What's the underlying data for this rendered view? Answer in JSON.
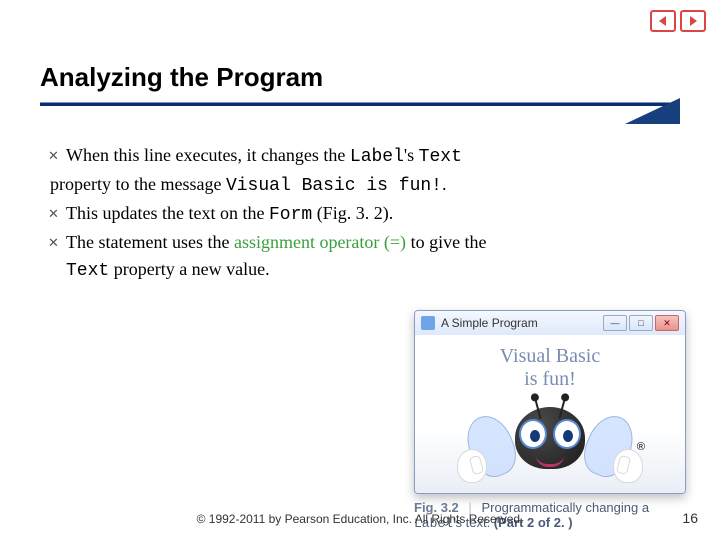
{
  "title": "Analyzing the Program",
  "bullets": {
    "b1_prefix": "When this line executes, it changes the ",
    "b1_label": "Label",
    "b1_poss": "'s ",
    "b1_text": "Text",
    "b1_line2a": "property to the message ",
    "b1_msg": "Visual Basic is fun!",
    "b1_line2b": ".",
    "b2_prefix": "This updates the text on the ",
    "b2_form": "Form",
    "b2_suffix": " (Fig. 3. 2).",
    "b3_prefix": "The statement uses the ",
    "b3_hl": "assignment operator (=) ",
    "b3_mid": "to give the ",
    "b3_text": "Text",
    "b3_suffix": " property a new value."
  },
  "window": {
    "title": "A Simple Program",
    "label_line1": "Visual Basic",
    "label_line2": "is fun!",
    "reg": "®"
  },
  "win_ctrl": {
    "min": "—",
    "max": "□",
    "close": "✕"
  },
  "caption": {
    "fig": "Fig. 3.2",
    "sep": "|",
    "pre": "Programmatically changing a ",
    "code": "Label",
    "post": "'s text. ",
    "part": "(Part 2 of 2. )"
  },
  "footer": "© 1992-2011 by Pearson Education, Inc. All Rights Reserved.",
  "pagenum": "16"
}
